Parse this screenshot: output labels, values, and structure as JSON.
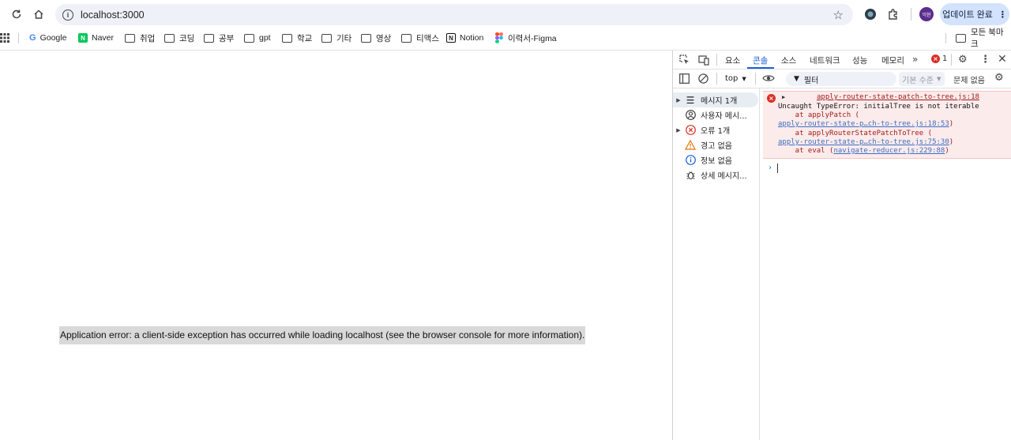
{
  "browser": {
    "url": "localhost:3000",
    "update_label": "업데이트 완료",
    "avatar_text": "익현"
  },
  "bookmarks": {
    "items": [
      {
        "label": "Google",
        "icon": "google-icon"
      },
      {
        "label": "Naver",
        "icon": "naver-icon"
      },
      {
        "label": "취업",
        "icon": "folder-icon"
      },
      {
        "label": "코딩",
        "icon": "folder-icon"
      },
      {
        "label": "공부",
        "icon": "folder-icon"
      },
      {
        "label": "gpt",
        "icon": "folder-icon"
      },
      {
        "label": "학교",
        "icon": "folder-icon"
      },
      {
        "label": "기타",
        "icon": "folder-icon"
      },
      {
        "label": "영상",
        "icon": "folder-icon"
      },
      {
        "label": "티맥스",
        "icon": "folder-icon"
      },
      {
        "label": "Notion",
        "icon": "notion-icon"
      },
      {
        "label": "이력서-Figma",
        "icon": "figma-icon"
      }
    ],
    "all_bookmarks": "모든 북마크"
  },
  "page": {
    "error_message": "Application error: a client-side exception has occurred while loading localhost (see the browser console for more information)."
  },
  "devtools": {
    "tabs": [
      "요소",
      "콘솔",
      "소스",
      "네트워크",
      "성능",
      "메모리"
    ],
    "active_tab": "콘솔",
    "error_count": "1",
    "context": "top",
    "filter_placeholder": "필터",
    "level": "기본 수준",
    "issues": "문제 없음",
    "sidebar": [
      {
        "label": "메시지 1개",
        "icon": "list-icon",
        "expandable": true
      },
      {
        "label": "사용자 메시...",
        "icon": "user-icon",
        "expandable": false
      },
      {
        "label": "오류 1개",
        "icon": "error-icon",
        "expandable": true
      },
      {
        "label": "경고 없음",
        "icon": "warning-icon",
        "expandable": false
      },
      {
        "label": "정보 없음",
        "icon": "info-icon",
        "expandable": false
      },
      {
        "label": "상세 메시지...",
        "icon": "bug-icon",
        "expandable": false
      }
    ],
    "console": {
      "source_link": "apply-router-state-patch-to-tree.js:18",
      "error_text": "Uncaught TypeError: initialTree is not iterable",
      "stack": [
        {
          "prefix": "    at applyPatch (",
          "link": "",
          "suffix": ""
        },
        {
          "prefix": "",
          "link": "apply-router-state-p…ch-to-tree.js:18:53",
          "suffix": ")"
        },
        {
          "prefix": "    at applyRouterStatePatchToTree (",
          "link": "",
          "suffix": ""
        },
        {
          "prefix": "",
          "link": "apply-router-state-p…ch-to-tree.js:75:30",
          "suffix": ")"
        },
        {
          "prefix": "    at eval (",
          "link": "navigate-reducer.js:229:88",
          "suffix": ")"
        }
      ]
    },
    "colors": {
      "accent": "#1a5fd6",
      "error_bg": "#fcebeb",
      "error_text": "#a21b1b",
      "link": "#3a6fc4"
    }
  }
}
